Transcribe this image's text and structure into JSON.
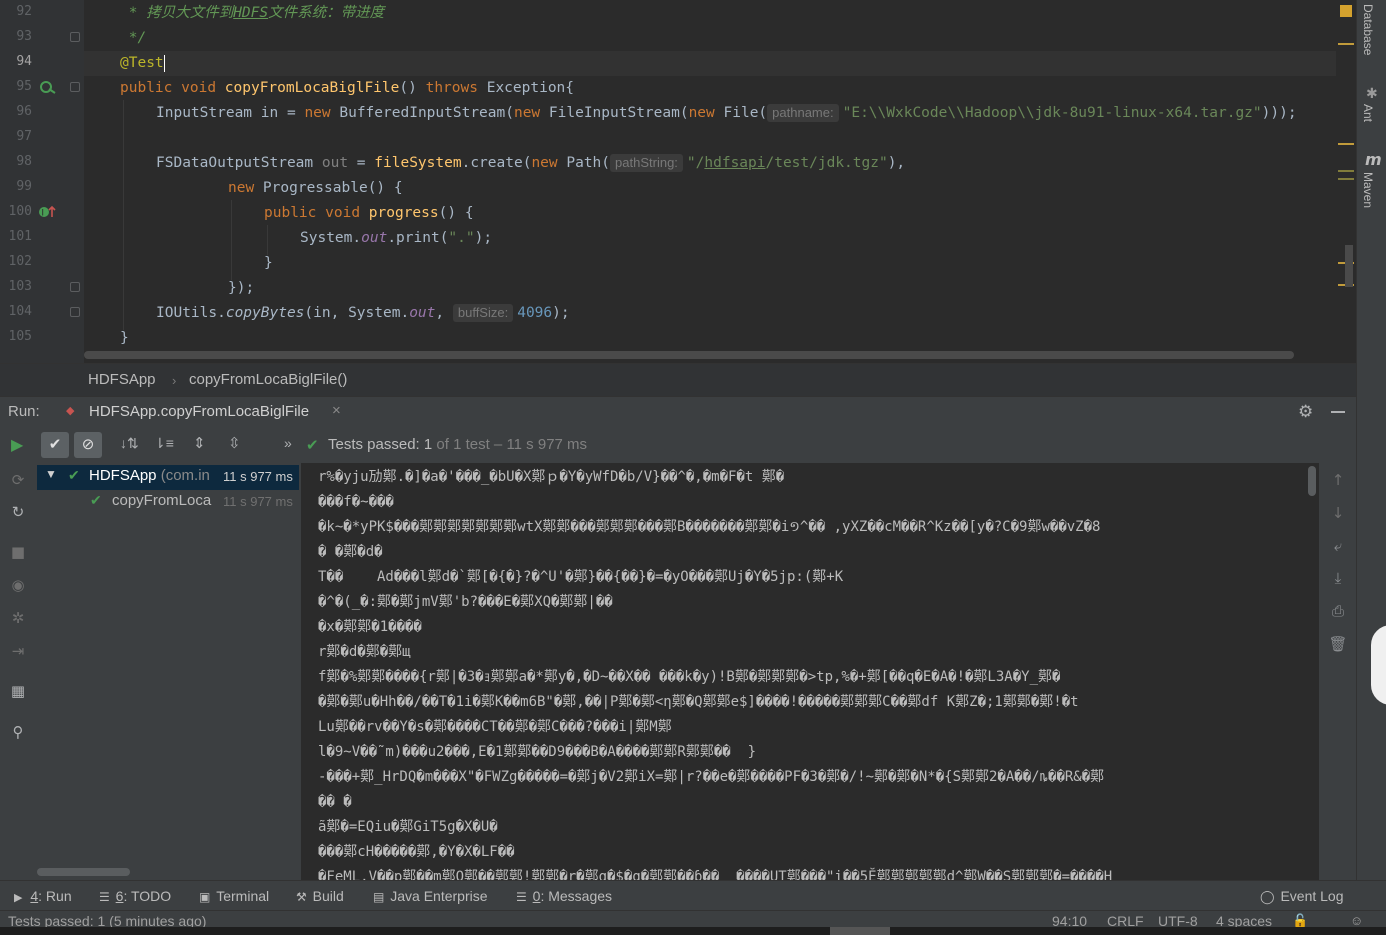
{
  "editor": {
    "line_numbers": [
      "92",
      "93",
      "94",
      "95",
      "96",
      "97",
      "98",
      "99",
      "100",
      "101",
      "102",
      "103",
      "104",
      "105"
    ],
    "current_line_number": "94",
    "comment_line_prefix": " * 拷贝大文件到",
    "comment_line_hdfs": "HDFS",
    "comment_line_suffix": "文件系统：带进度",
    "comment_close": " */",
    "annotation": "@Test",
    "kw_public": "public",
    "kw_void": "void",
    "method_name": "copyFromLocaBiglFile",
    "parens_open": "() ",
    "kw_throws": "throws",
    "exception_clause": " Exception{",
    "l96_type": "InputStream ",
    "l96_var": "in",
    "l96_eq": " = ",
    "kw_new": "new",
    "l96_bis": " BufferedInputStream(",
    "l96_fis": " FileInputStream(",
    "l96_file": " File(",
    "hint_pathname": "pathname:",
    "l96_path": "\"E:\\\\WxkCode\\\\Hadoop\\\\jdk-8u91-linux-x64.tar.gz\"",
    "l96_close": ")));",
    "l98_type": "FSDataOutputStream ",
    "l98_var": "out",
    "l98_eq": " = ",
    "l98_fs": "fileSystem",
    "l98_create": ".create(",
    "l98_path": " Path(",
    "hint_pathstring": "pathString:",
    "l98_str_q": "\"/",
    "l98_str_hdfs": "hdfsapi",
    "l98_str_rest": "/test/jdk.tgz\"",
    "l98_close": "),",
    "l99_prog": " Progressable() {",
    "l100_progress": "progress",
    "l100_rest": "() {",
    "l101_sys": "System.",
    "l101_out": "out",
    "l101_print": ".print(",
    "l101_dot": "\".\"",
    "l101_close": ");",
    "l102": "}",
    "l103": "});",
    "l104_io": "IOUtils.",
    "l104_copy": "copyBytes",
    "l104_args": "(in, System.",
    "l104_out": "out",
    "l104_comma": ", ",
    "hint_buffsize": "buffSize:",
    "l104_num": "4096",
    "l104_close": ");",
    "l105": "}"
  },
  "right_stripe": {
    "database": "Database",
    "ant": "Ant",
    "maven": "Maven"
  },
  "breadcrumb": {
    "class": "HDFSApp",
    "method": "copyFromLocaBiglFile()"
  },
  "run_panel": {
    "label": "Run:",
    "config_tab": "HDFSApp.copyFromLocaBiglFile",
    "close_glyph": "×",
    "status_bold": "Tests passed: ",
    "status_count": "1",
    "status_rest": " of 1 test – 11 s 977 ms",
    "chevrons": "»"
  },
  "test_tree": [
    {
      "name": "HDFSApp",
      "detail": " (com.in",
      "time": "11 s 977 ms"
    },
    {
      "name": "copyFromLoca",
      "detail": "",
      "time": "11 s 977 ms"
    }
  ],
  "console_lines": [
    "r%�yju劢鄚.�]�a�'���_�bU�X鄚ｐ�Y�yWfD�b/V}��^�,�m�F�t 鄚�",
    "���f�~���",
    "�k~�*yPK$���鄚鄚鄚鄚鄚鄚鄚wtX鄚鄚���鄚鄚鄚���鄚B�������鄚鄚�i១^�� ,yXZ��cM��R^Kz��[y�?C�9鄚w��vZ�8",
    "� �鄚�d�",
    "T��    Ad���l鄚d�`鄚[�{�}?�^U'�鄚}��{��}�=�yO���鄚Uj�Y�5jp:(鄚+K",
    "�^�(_�:鄚�鄚jmV鄚'b?���E�鄚XQ�鄚鄚|��",
    "�x�鄚鄚�1����",
    "r鄚�d�鄚�鄚щ",
    "f鄚�%鄚鄚����{r鄚|�3�ｮ鄚鄚a�*鄚y�,�D~��X�� ���k�y)!B鄚�鄚鄚鄚�>tp,%�+鄚[��q�E�A�!�鄚L3A�Y_鄚�",
    "�鄚�鄚u�Hh��/��T�1i�鄚K��m6B\"�鄚,��|P鄚�鄚<η鄚�Q鄚鄚e$]����!�����鄚鄚鄚C��鄚df K鄚Z�;1鄚鄚�鄚!�t",
    "Lu鄚��rv��Y�s�鄚����CT��鄚�鄚C���?���i|鄚M鄚",
    "l�9~V��˜m)���u2���,E�1鄚鄚��D9���B�A����鄚鄚R鄚鄚��  }",
    "-���+鄚_HrDQ�m���X\"�FWZg�����=�鄚j�V2鄚iX=鄚|r?��e�鄚����PF�3�鄚�/!~鄚�鄚�N*�{S鄚鄚2�A��/ȵ��R&�鄚",
    "�� �",
    "ã鄚�=EQiu�鄚GiT5g�X�U�",
    "���鄚cH�����鄚,�Y�X�LF��",
    "�FeML.V��p鄚��m鄚O鄚��鄚鄚!鄚鄚�r�鄚g�$�q�鄚鄚��ɓ��  ����UT鄚���\"i��5Ĕ鄚鄚鄚鄚鄚d^鄚W��S鄚鄚鄚�=����H"
  ],
  "tool_tabs": [
    {
      "num": "4",
      "label": ": Run"
    },
    {
      "num": "6",
      "label": ": TODO"
    },
    {
      "num": "",
      "label": "Terminal"
    },
    {
      "num": "",
      "label": "Build"
    },
    {
      "num": "",
      "label": "Java Enterprise"
    },
    {
      "num": "0",
      "label": ": Messages"
    }
  ],
  "event_log": "Event Log",
  "status": {
    "message": "Tests passed: 1 (5 minutes ago)",
    "position": "94:10",
    "line_sep": "CRLF",
    "encoding": "UTF-8",
    "indent": "4 spaces"
  },
  "colors": {
    "editor_bg": "#2b2b2b",
    "panel_bg": "#3c3f41",
    "keyword": "#cc7832",
    "function": "#ffc66d",
    "string": "#6a8759",
    "number": "#6897bb",
    "field": "#9876aa",
    "comment": "#629755",
    "annotation": "#bbb529",
    "pass_green": "#499c54",
    "selection": "#0d293e"
  }
}
